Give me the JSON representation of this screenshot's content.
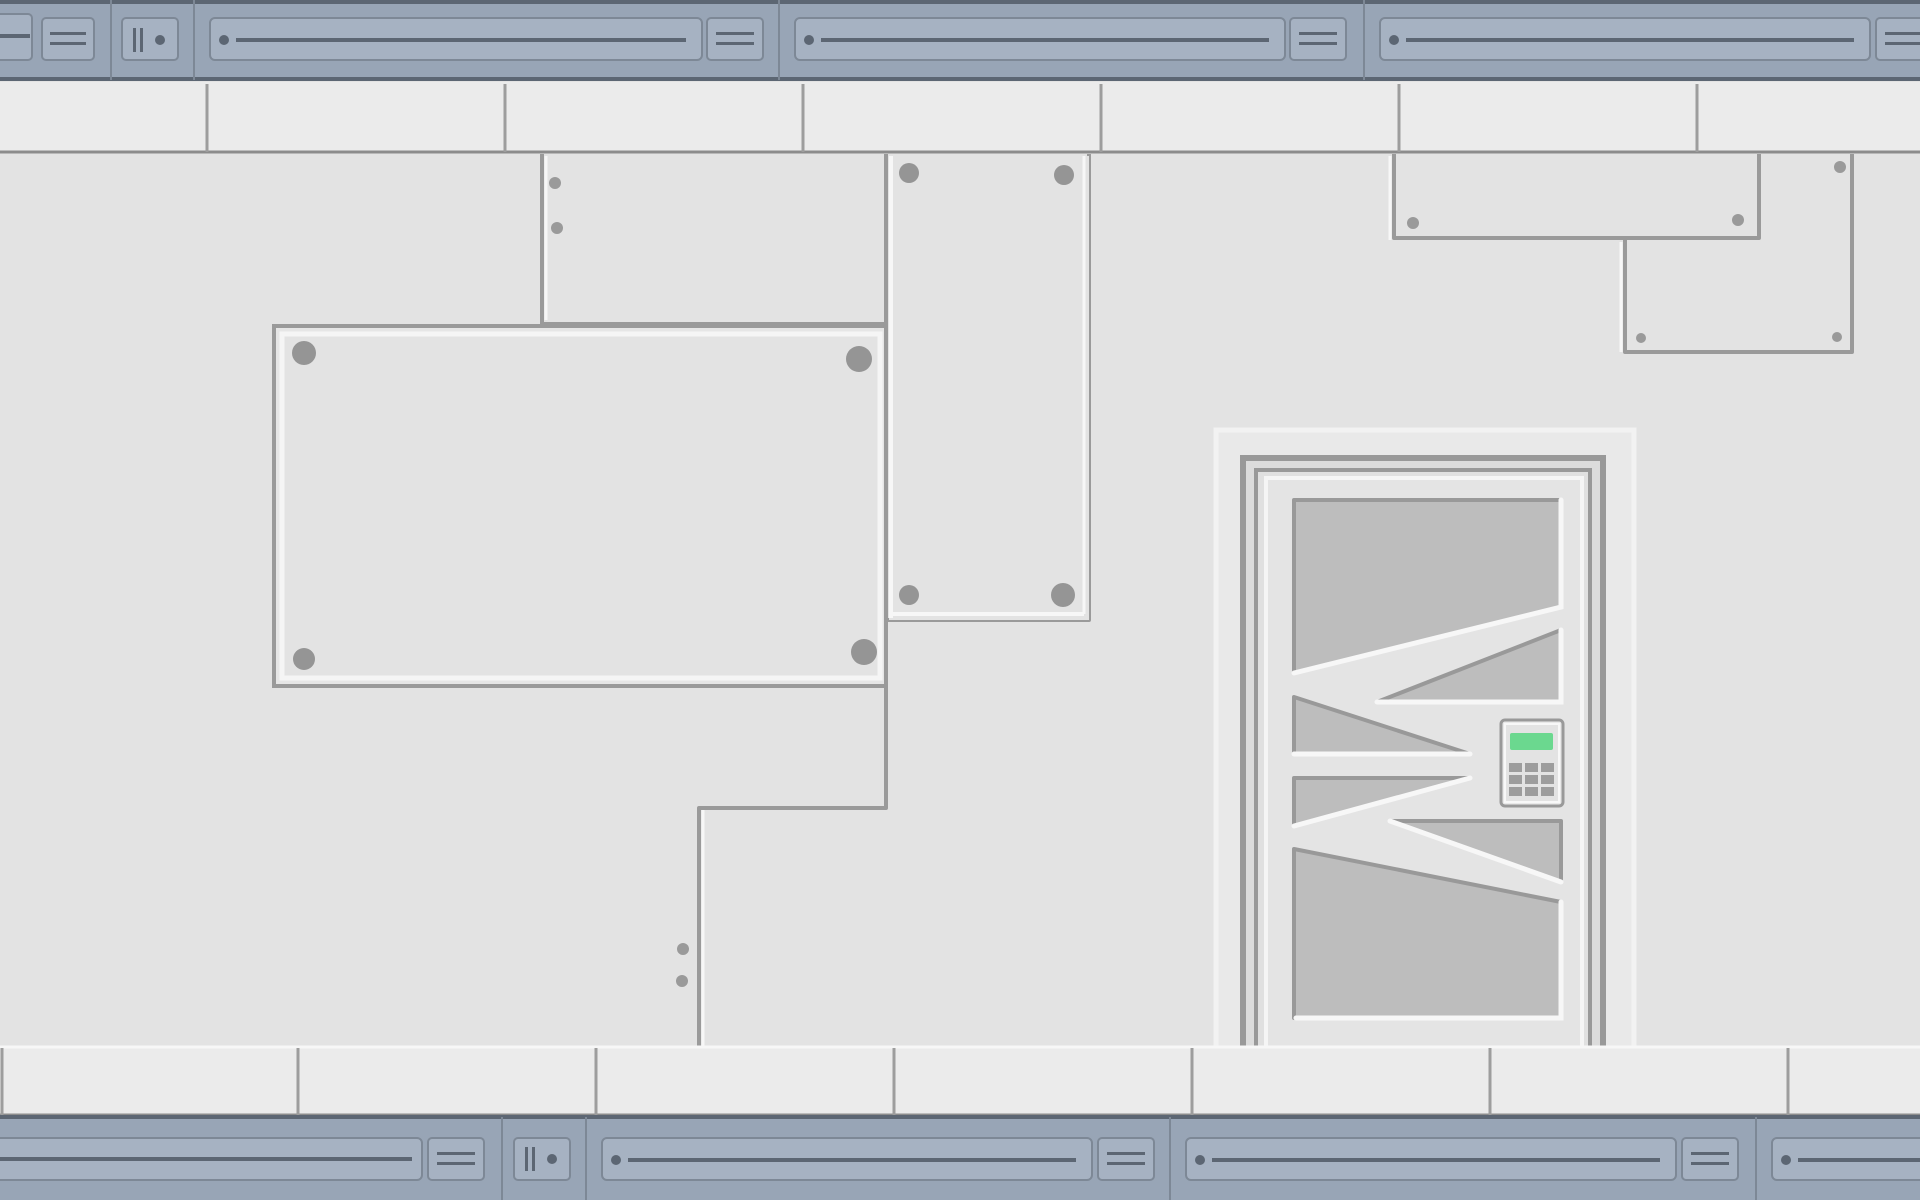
{
  "scene": {
    "type": "sci-fi corridor background",
    "elements": [
      "ceiling-rail",
      "floor-rail",
      "wall-panels",
      "rivets",
      "sliding-door",
      "door-keypad"
    ]
  },
  "colors": {
    "wall": "#e3e3e3",
    "wall_highlight": "#f2f2f2",
    "panel_seam": "#999999",
    "rivet": "#959595",
    "trim_strip": "#ebebeb",
    "rail_metal": "#98a5b6",
    "rail_dark": "#5c6673",
    "rail_outline": "#3d444d",
    "door_glass": "#bdbdbd",
    "door_frame": "#dcdcdc",
    "keypad_screen": "#6bd88f"
  },
  "door": {
    "keypad_icon": "keypad-icon",
    "screen_color": "#6bd88f"
  }
}
